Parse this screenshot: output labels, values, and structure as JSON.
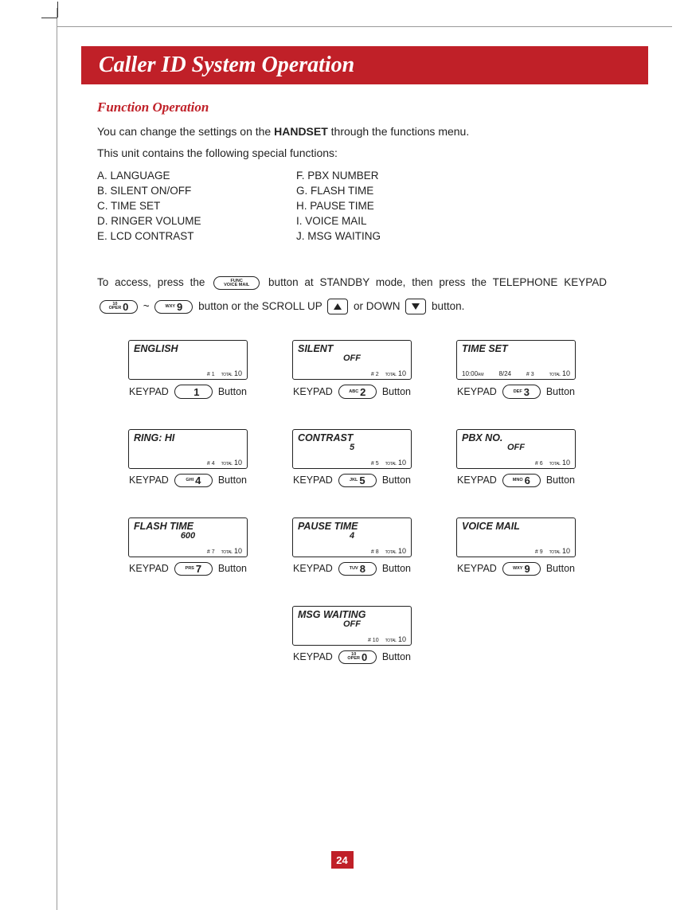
{
  "page_number": "24",
  "title": "Caller ID System Operation",
  "section": {
    "heading": "Function Operation",
    "intro1_a": "You can change the settings on the ",
    "intro1_bold": "HANDSET",
    "intro1_b": " through the functions menu.",
    "intro2": "This unit contains the following special functions:",
    "functions_left": [
      "A.   LANGUAGE",
      "B.   SILENT ON/OFF",
      "C.   TIME SET",
      "D.   RINGER VOLUME",
      "E.   LCD CONTRAST"
    ],
    "functions_right": [
      "F.    PBX NUMBER",
      "G.   FLASH TIME",
      "H.   PAUSE TIME",
      "I.     VOICE MAIL",
      "J.    MSG WAITING"
    ]
  },
  "access": {
    "t1": "To access, press the ",
    "func_btn_top": "FUNC",
    "func_btn_bot": "VOICE MAIL",
    "t2": " button at STANDBY mode, then press the TELEPHONE KEYPAD ",
    "key0_top": "10",
    "key0_bot": "OPER",
    "key0_big": "0",
    "tilde": " ~ ",
    "key9_lbl": "WXY",
    "key9_big": "9",
    "t3": " button or the SCROLL UP ",
    "t4": " or DOWN ",
    "t5": " button."
  },
  "lcds": [
    {
      "title": "ENGLISH",
      "sub": "",
      "bottom_mode": "right",
      "hash": "# 1",
      "total": "10",
      "key_label": "",
      "key_big": "1"
    },
    {
      "title": "SILENT",
      "sub": "OFF",
      "bottom_mode": "right",
      "hash": "# 2",
      "total": "10",
      "key_label": "ABC",
      "key_big": "2"
    },
    {
      "title": "TIME SET",
      "sub": "",
      "bottom_mode": "spread",
      "time": "10:00",
      "ampm": "AM",
      "date": "8/24",
      "hash": "# 3",
      "total": "10",
      "key_label": "DEF",
      "key_big": "3"
    },
    {
      "title": "RING: HI",
      "sub": "",
      "bottom_mode": "right",
      "hash": "# 4",
      "total": "10",
      "key_label": "GHI",
      "key_big": "4"
    },
    {
      "title": "CONTRAST",
      "sub": "5",
      "bottom_mode": "right",
      "hash": "# 5",
      "total": "10",
      "key_label": "JKL",
      "key_big": "5"
    },
    {
      "title": "PBX NO.",
      "sub": "OFF",
      "bottom_mode": "right",
      "hash": "# 6",
      "total": "10",
      "key_label": "MNO",
      "key_big": "6"
    },
    {
      "title": "FLASH TIME",
      "sub": "600",
      "bottom_mode": "right",
      "hash": "# 7",
      "total": "10",
      "key_label": "PRS",
      "key_big": "7"
    },
    {
      "title": "PAUSE TIME",
      "sub": "4",
      "bottom_mode": "right",
      "hash": "# 8",
      "total": "10",
      "key_label": "TUV",
      "key_big": "8"
    },
    {
      "title": "VOICE MAIL",
      "sub": "",
      "bottom_mode": "right",
      "hash": "# 9",
      "total": "10",
      "key_label": "WXY",
      "key_big": "9"
    },
    {
      "title": "MSG WAITING",
      "sub": "OFF",
      "bottom_mode": "right",
      "hash": "# 10",
      "total": "10",
      "key_label": "OPER",
      "key_top": "10",
      "key_big": "0"
    }
  ],
  "labels": {
    "keypad": "KEYPAD",
    "button": "Button",
    "total": "TOTAL"
  }
}
